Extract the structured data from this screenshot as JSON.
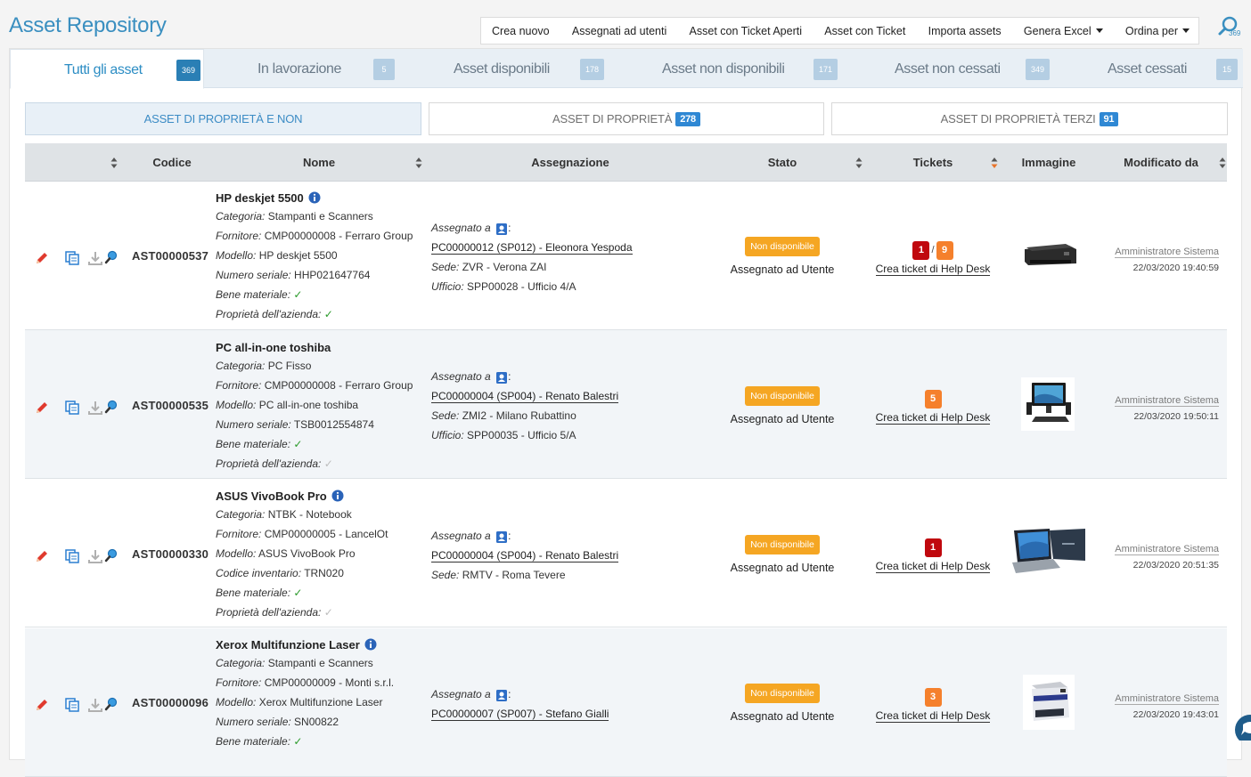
{
  "app": {
    "title": "Asset Repository"
  },
  "toolbar": {
    "items": [
      {
        "label": "Crea nuovo"
      },
      {
        "label": "Assegnati ad utenti"
      },
      {
        "label": "Asset con Ticket Aperti"
      },
      {
        "label": "Asset con Ticket"
      },
      {
        "label": "Importa assets"
      },
      {
        "label": "Genera Excel"
      },
      {
        "label": "Ordina per"
      }
    ],
    "search_count": "369"
  },
  "tabs": [
    {
      "label": "Tutti gli asset",
      "count": "369"
    },
    {
      "label": "In lavorazione",
      "count": "5"
    },
    {
      "label": "Asset disponibili",
      "count": "178"
    },
    {
      "label": "Asset non disponibili",
      "count": "171"
    },
    {
      "label": "Asset non cessati",
      "count": "349"
    },
    {
      "label": "Asset cessati",
      "count": "15"
    }
  ],
  "ownership": [
    {
      "label": "ASSET DI PROPRIETÀ E NON",
      "count": ""
    },
    {
      "label": "ASSET DI PROPRIETÀ",
      "count": "278"
    },
    {
      "label": "ASSET DI PROPRIETÀ TERZI",
      "count": "91"
    }
  ],
  "columns": {
    "codice": "Codice",
    "nome": "Nome",
    "assegnazione": "Assegnazione",
    "stato": "Stato",
    "tickets": "Tickets",
    "immagine": "Immagine",
    "modificato": "Modificato da"
  },
  "labels": {
    "categoria": "Categoria:",
    "fornitore": "Fornitore:",
    "modello": "Modello:",
    "numero_seriale": "Numero seriale:",
    "codice_inventario": "Codice inventario:",
    "bene_materiale": "Bene materiale:",
    "proprieta": "Proprietà dell'azienda:",
    "assegnato_a": "Assegnato a",
    "sede": "Sede:",
    "ufficio": "Ufficio:",
    "crea_ticket": "Crea ticket di Help Desk",
    "check": "✓"
  },
  "rows": [
    {
      "code": "AST00000537",
      "name": "HP deskjet 5500",
      "categoria": "Stampanti e Scanners",
      "fornitore": "CMP00000008 - Ferraro Group",
      "modello": "HP deskjet 5500",
      "extra_label": "Numero seriale:",
      "extra_value": "HHP021647764",
      "bene_materiale": true,
      "proprieta": true,
      "assegnato": "PC00000012 (SP012) - Eleonora Yespoda",
      "sede": "ZVR - Verona ZAI",
      "ufficio": "SPP00028 - Ufficio 4/A",
      "stato_badge": "Non disponibile",
      "stato_text": "Assegnato ad Utente",
      "tickets": [
        {
          "value": "1",
          "color": "red"
        },
        {
          "value": "9",
          "color": "orange"
        }
      ],
      "ticket_sep": "/",
      "image_kind": "printer-image",
      "mod_user": "Amministratore Sistema",
      "mod_date": "22/03/2020 19:40:59"
    },
    {
      "code": "AST00000535",
      "name": "PC all-in-one toshiba",
      "categoria": "PC Fisso",
      "fornitore": "CMP00000008 - Ferraro Group",
      "modello": "PC all-in-one toshiba",
      "extra_label": "Numero seriale:",
      "extra_value": "TSB0012554874",
      "bene_materiale": true,
      "proprieta": false,
      "assegnato": "PC00000004 (SP004) - Renato Balestri",
      "sede": "ZMI2 - Milano Rubattino",
      "ufficio": "SPP00035 - Ufficio 5/A",
      "stato_badge": "Non disponibile",
      "stato_text": "Assegnato ad Utente",
      "tickets": [
        {
          "value": "5",
          "color": "orange"
        }
      ],
      "ticket_sep": "",
      "image_kind": "desktop-pc-image",
      "mod_user": "Amministratore Sistema",
      "mod_date": "22/03/2020 19:50:11"
    },
    {
      "code": "AST00000330",
      "name": "ASUS VivoBook Pro",
      "categoria": "NTBK - Notebook",
      "fornitore": "CMP00000005 - LancelOt",
      "modello": "ASUS VivoBook Pro",
      "extra_label": "Codice inventario:",
      "extra_value": "TRN020",
      "bene_materiale": true,
      "proprieta": false,
      "assegnato": "PC00000004 (SP004) - Renato Balestri",
      "sede": "RMTV - Roma Tevere",
      "ufficio": "",
      "stato_badge": "Non disponibile",
      "stato_text": "Assegnato ad Utente",
      "tickets": [
        {
          "value": "1",
          "color": "red"
        }
      ],
      "ticket_sep": "",
      "image_kind": "laptop-image",
      "mod_user": "Amministratore Sistema",
      "mod_date": "22/03/2020 20:51:35"
    },
    {
      "code": "AST00000096",
      "name": "Xerox Multifunzione Laser",
      "categoria": "Stampanti e Scanners",
      "fornitore": "CMP00000009 - Monti s.r.l.",
      "modello": "Xerox Multifunzione Laser",
      "extra_label": "Numero seriale:",
      "extra_value": "SN00822",
      "bene_materiale": true,
      "proprieta": false,
      "assegnato": "PC00000007 (SP007) - Stefano Gialli",
      "sede": "",
      "ufficio": "",
      "stato_badge": "Non disponibile",
      "stato_text": "Assegnato ad Utente",
      "tickets": [
        {
          "value": "3",
          "color": "orange"
        }
      ],
      "ticket_sep": "",
      "image_kind": "multifunction-printer-image",
      "mod_user": "Amministratore Sistema",
      "mod_date": "22/03/2020 19:43:01"
    }
  ]
}
